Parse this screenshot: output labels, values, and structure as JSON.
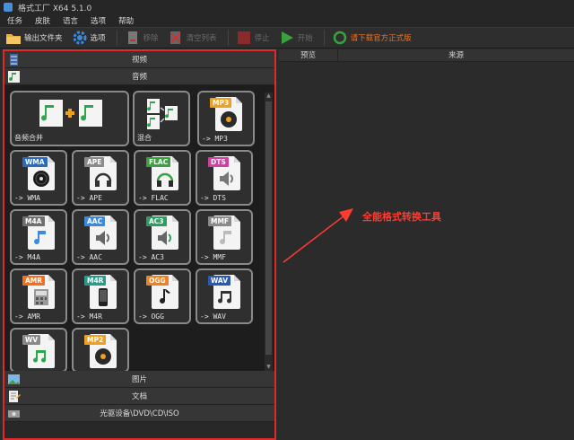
{
  "window": {
    "title": "格式工厂 X64 5.1.0"
  },
  "menu": [
    "任务",
    "皮肤",
    "语言",
    "选项",
    "帮助"
  ],
  "toolbar": {
    "output_folder": "输出文件夹",
    "options": "选项",
    "remove": "移除",
    "clear_list": "清空列表",
    "stop": "停止",
    "start": "开始",
    "download_full": "请下载官方正式版"
  },
  "categories": {
    "video": "视频",
    "audio": "音频",
    "image": "图片",
    "document": "文档",
    "disc": "光驱设备\\DVD\\CD\\ISO"
  },
  "tiles": [
    {
      "label": "音频合并",
      "badge": "",
      "color": "#2aa84a",
      "icon": "audio-merge-icon"
    },
    {
      "label": "混合",
      "badge": "",
      "color": "#2aa84a",
      "icon": "mix-icon"
    },
    {
      "label": "-> MP3",
      "badge": "MP3",
      "color": "#f0a020",
      "icon": "record-icon"
    },
    {
      "label": "-> WMA",
      "badge": "WMA",
      "color": "#2a6ac0",
      "icon": "disc-icon"
    },
    {
      "label": "-> APE",
      "badge": "APE",
      "color": "#8a8a8a",
      "icon": "headphones-icon"
    },
    {
      "label": "-> FLAC",
      "badge": "FLAC",
      "color": "#3aa040",
      "icon": "headphones-icon"
    },
    {
      "label": "-> DTS",
      "badge": "DTS",
      "color": "#d040a0",
      "icon": "speaker-icon"
    },
    {
      "label": "-> M4A",
      "badge": "M4A",
      "color": "#707070",
      "icon": "note-icon"
    },
    {
      "label": "-> AAC",
      "badge": "AAC",
      "color": "#3a8ae0",
      "icon": "speaker-icon"
    },
    {
      "label": "-> AC3",
      "badge": "AC3",
      "color": "#2aa060",
      "icon": "speaker-icon"
    },
    {
      "label": "-> MMF",
      "badge": "MMF",
      "color": "#8a8a8a",
      "icon": "note-icon"
    },
    {
      "label": "-> AMR",
      "badge": "AMR",
      "color": "#f07020",
      "icon": "keypad-icon"
    },
    {
      "label": "-> M4R",
      "badge": "M4R",
      "color": "#2a9a8a",
      "icon": "phone-icon"
    },
    {
      "label": "-> OGG",
      "badge": "OGG",
      "color": "#f08020",
      "icon": "note-icon"
    },
    {
      "label": "-> WAV",
      "badge": "WAV",
      "color": "#2a5ab0",
      "icon": "note-icon"
    },
    {
      "label": "",
      "badge": "WV",
      "color": "#8a8a8a",
      "icon": "note-icon"
    },
    {
      "label": "",
      "badge": "MP2",
      "color": "#f0a020",
      "icon": "record-icon"
    }
  ],
  "list": {
    "col_preview": "预览",
    "col_source": "来源"
  },
  "annotation": "全能格式转换工具",
  "colors": {
    "highlight": "#e02a2a",
    "annotation": "#ff3b30"
  }
}
